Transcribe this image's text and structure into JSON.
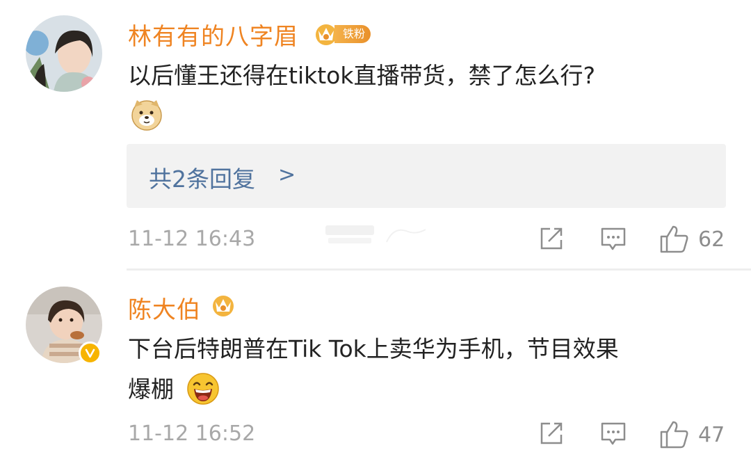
{
  "comments": [
    {
      "username": "林有有的八字眉",
      "fan_badge": "铁粉",
      "text": "以后懂王还得在tiktok直播带货，禁了怎么行?",
      "emoji_icon": "doge-emoji-icon",
      "replies_label": "共2条回复",
      "replies_arrow": ">",
      "timestamp": "11-12 16:43",
      "likes": "62"
    },
    {
      "username": "陈大伯",
      "text_line1": "下台后特朗普在Tik Tok上卖华为手机，节目效果",
      "text_line2": "爆棚",
      "emoji_icon": "laughing-emoji-icon",
      "timestamp": "11-12 16:52",
      "likes": "47"
    }
  ],
  "colors": {
    "username": "#ef8422",
    "link": "#50739e",
    "meta": "#a8a8a8",
    "verified_badge": "#f7b400"
  }
}
